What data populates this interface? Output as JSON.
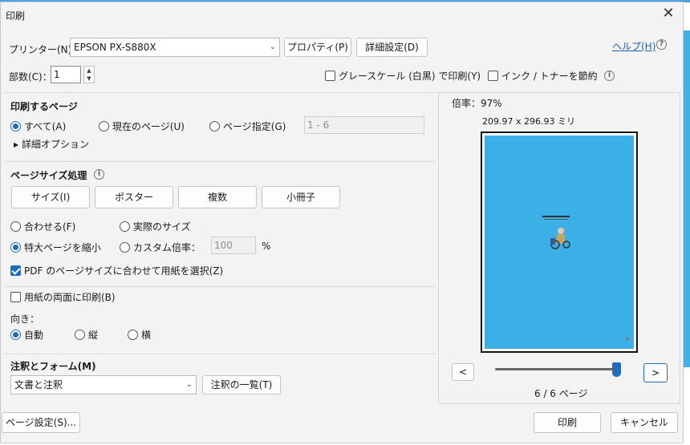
{
  "window": {
    "title": "印刷",
    "close_glyph": "✕"
  },
  "printer": {
    "label": "プリンター(N)：",
    "selected": "EPSON PX-S880X",
    "properties_button": "プロパティ(P)",
    "advanced_button": "詳細設定(D)",
    "help_link": "ヘルプ(H)"
  },
  "copies": {
    "label": "部数(C)：",
    "value": "1"
  },
  "options": {
    "grayscale_label": "グレースケール (白黒) で印刷(Y)",
    "grayscale_checked": false,
    "save_ink_label": "インク / トナーを節約",
    "save_ink_checked": false
  },
  "pages_to_print": {
    "title": "印刷するページ",
    "all_label": "すべて(A)",
    "current_label": "現在のページ(U)",
    "range_label": "ページ指定(G)",
    "range_value": "1 - 6",
    "selected": "all",
    "more_options": "詳細オプション"
  },
  "page_sizing": {
    "title": "ページサイズ処理",
    "buttons": [
      "サイズ(I)",
      "ポスター",
      "複数",
      "小冊子"
    ],
    "fit_label": "合わせる(F)",
    "actual_label": "実際のサイズ",
    "shrink_label": "特大ページを縮小",
    "custom_label": "カスタム倍率：",
    "custom_value": "100",
    "percent": "%",
    "selected": "shrink",
    "choose_paper_label": "PDF のページサイズに合わせて用紙を選択(Z)",
    "choose_paper_checked": true
  },
  "duplex": {
    "label": "用紙の両面に印刷(B)",
    "checked": false
  },
  "orientation": {
    "title": "向き：",
    "auto_label": "自動",
    "portrait_label": "縦",
    "landscape_label": "横",
    "selected": "auto"
  },
  "comments_forms": {
    "title": "注釈とフォーム(M)",
    "selected": "文書と注釈",
    "summary_button": "注釈の一覧(T)"
  },
  "preview": {
    "scale_label": "倍率：",
    "scale_value": "97%",
    "dimensions": "209.97 x 296.93 ミリ",
    "prev_button": "<",
    "next_button": ">",
    "page_indicator": "6 / 6 ページ",
    "page_position_fraction": 1.0,
    "page_color": "#3ab0e6"
  },
  "footer": {
    "page_setup_button": "ページ設定(S)...",
    "print_button": "印刷",
    "cancel_button": "キャンセル"
  },
  "icons": {
    "info": "info-icon",
    "help": "question-circle-icon",
    "expand": "triangle-right-icon",
    "dropdown": "chevron-down-icon"
  }
}
